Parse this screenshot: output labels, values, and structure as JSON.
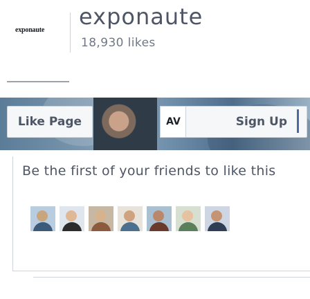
{
  "page": {
    "logo_text": "exponaute",
    "name": "exponaute",
    "likes": "18,930 likes"
  },
  "cover": {
    "like_button": "Like Page",
    "mid_label": "AV",
    "signup_button": "Sign Up"
  },
  "friends": {
    "heading": "Be the first of your friends to like this",
    "avatars": [
      {
        "name": "friend-avatar-1",
        "face": "#c9a57e",
        "body": "#3c5a7a",
        "bg": "#b9cde0"
      },
      {
        "name": "friend-avatar-2",
        "face": "#e0b896",
        "body": "#2c2c2c",
        "bg": "#dfe6ee"
      },
      {
        "name": "friend-avatar-3",
        "face": "#d7b38d",
        "body": "#8c5a3c",
        "bg": "#c7b8a3"
      },
      {
        "name": "friend-avatar-4",
        "face": "#cfa37f",
        "body": "#4a6f8f",
        "bg": "#e7e2da"
      },
      {
        "name": "friend-avatar-5",
        "face": "#b9876a",
        "body": "#6a3a2a",
        "bg": "#a9c0d2"
      },
      {
        "name": "friend-avatar-6",
        "face": "#e6c2a0",
        "body": "#5b7f5b",
        "bg": "#d6dfd0"
      },
      {
        "name": "friend-avatar-7",
        "face": "#c49473",
        "body": "#2f3e55",
        "bg": "#cdd6e2"
      }
    ]
  },
  "colors": {
    "text_primary": "#4e5665",
    "text_secondary": "#6f7888",
    "border": "#cfd4dc",
    "button_bg": "#f6f7f9",
    "accent": "#4e69a2"
  }
}
